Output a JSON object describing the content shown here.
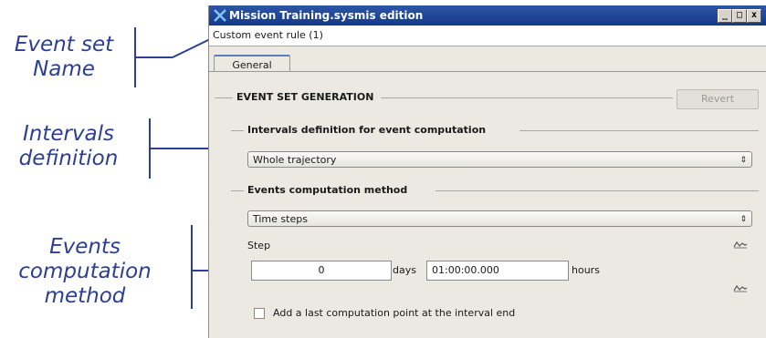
{
  "annotations": {
    "event_set_name": [
      "Event set",
      "Name"
    ],
    "intervals_definition": [
      "Intervals",
      "definition"
    ],
    "events_computation_method": [
      "Events",
      "computation",
      "method"
    ]
  },
  "window": {
    "title": "Mission Training.sysmis edition",
    "controls": [
      "_",
      "□",
      "x"
    ]
  },
  "event_set_name": "Custom event rule (1)",
  "tabs": [
    {
      "label": "General",
      "active": true
    }
  ],
  "event_set_generation": {
    "title": "EVENT SET GENERATION",
    "revert_label": "Revert",
    "revert_enabled": false
  },
  "intervals": {
    "title": "Intervals definition for event computation",
    "selected": "Whole trajectory"
  },
  "computation": {
    "title": "Events computation method",
    "selected": "Time steps",
    "step_label": "Step",
    "days_value": "0",
    "days_unit": "days",
    "hours_value": "01:00:00.000",
    "hours_unit": "hours"
  },
  "last_point": {
    "label": "Add a last computation point at the interval end",
    "checked": false
  },
  "colors": {
    "annotation": "#2c3f93",
    "titlebar": "#1f4596"
  },
  "icons": {
    "app": "x-logo-icon",
    "step_side": "curve-icon"
  }
}
